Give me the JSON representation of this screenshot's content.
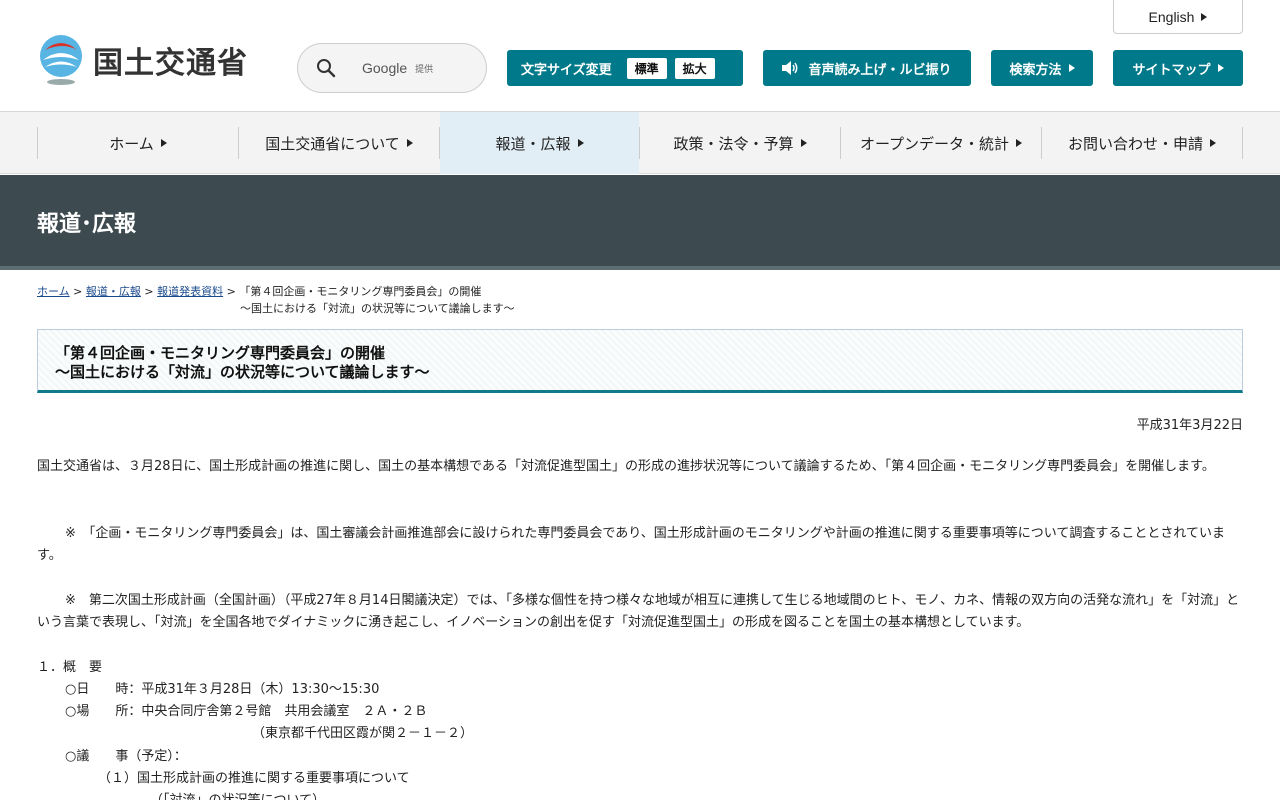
{
  "header": {
    "logo_text": "国土交通省",
    "search": {
      "label": "Google",
      "sub": "提供"
    },
    "lang_button": "English",
    "font_size": {
      "label": "文字サイズ変更",
      "options": [
        "標準",
        "拡大"
      ]
    },
    "voice_button": "音声読み上げ・ルビ振り",
    "howto_button": "検索方法",
    "sitemap_button": "サイトマップ"
  },
  "nav": {
    "items": [
      {
        "label": "ホーム"
      },
      {
        "label": "国土交通省について"
      },
      {
        "label": "報道・広報"
      },
      {
        "label": "政策・法令・予算"
      },
      {
        "label": "オープンデータ・統計"
      },
      {
        "label": "お問い合わせ・申請"
      }
    ],
    "active_index": 2
  },
  "banner": {
    "title": "報道･広報"
  },
  "breadcrumb": {
    "links": [
      "ホーム",
      "報道・広報",
      "報道発表資料"
    ],
    "current": "「第４回企画・モニタリング専門委員会」の開催",
    "current_sub": "～国土における「対流」の状況等について議論します～"
  },
  "article": {
    "title_line1": "「第４回企画・モニタリング専門委員会」の開催",
    "title_line2": "～国土における「対流」の状況等について議論します～",
    "date": "平成31年3月22日",
    "para1": "国土交通省は、３月28日に、国土形成計画の推進に関し、国土の基本構想である「対流促進型国土」の形成の進捗状況等について議論するため、「第４回企画・モニタリング専門委員会」を開催します。",
    "para2": "※　「企画・モニタリング専門委員会」は、国土審議会計画推進部会に設けられた専門委員会であり、国土形成計画のモニタリングや計画の推進に関する重要事項等について調査することとされています。",
    "para3": "※　第二次国土形成計画（全国計画）（平成27年８月14日閣議決定）では、「多様な個性を持つ様々な地域が相互に連携して生じる地域間のヒト、モノ、カネ、情報の双方向の活発な流れ」を「対流」という言葉で表現し、「対流」を全国各地でダイナミックに湧き起こし、イノベーションの創出を促す「対流促進型国土」の形成を図ることを国土の基本構想としています。",
    "overview_heading": "１．概　要",
    "date_line": "○日　　時：平成31年３月28日（木）13:30～15:30",
    "place_line": "○場　　所：中央合同庁舎第２号館　共用会議室　２Ａ・２Ｂ",
    "address_line": "（東京都千代田区霞が関２－１－２）",
    "agenda_line": "○議　　事（予定）：",
    "agenda_item1": "（１）国土形成計画の推進に関する重要事項について",
    "agenda_item1_sub": "（「対流」の状況等について）"
  }
}
